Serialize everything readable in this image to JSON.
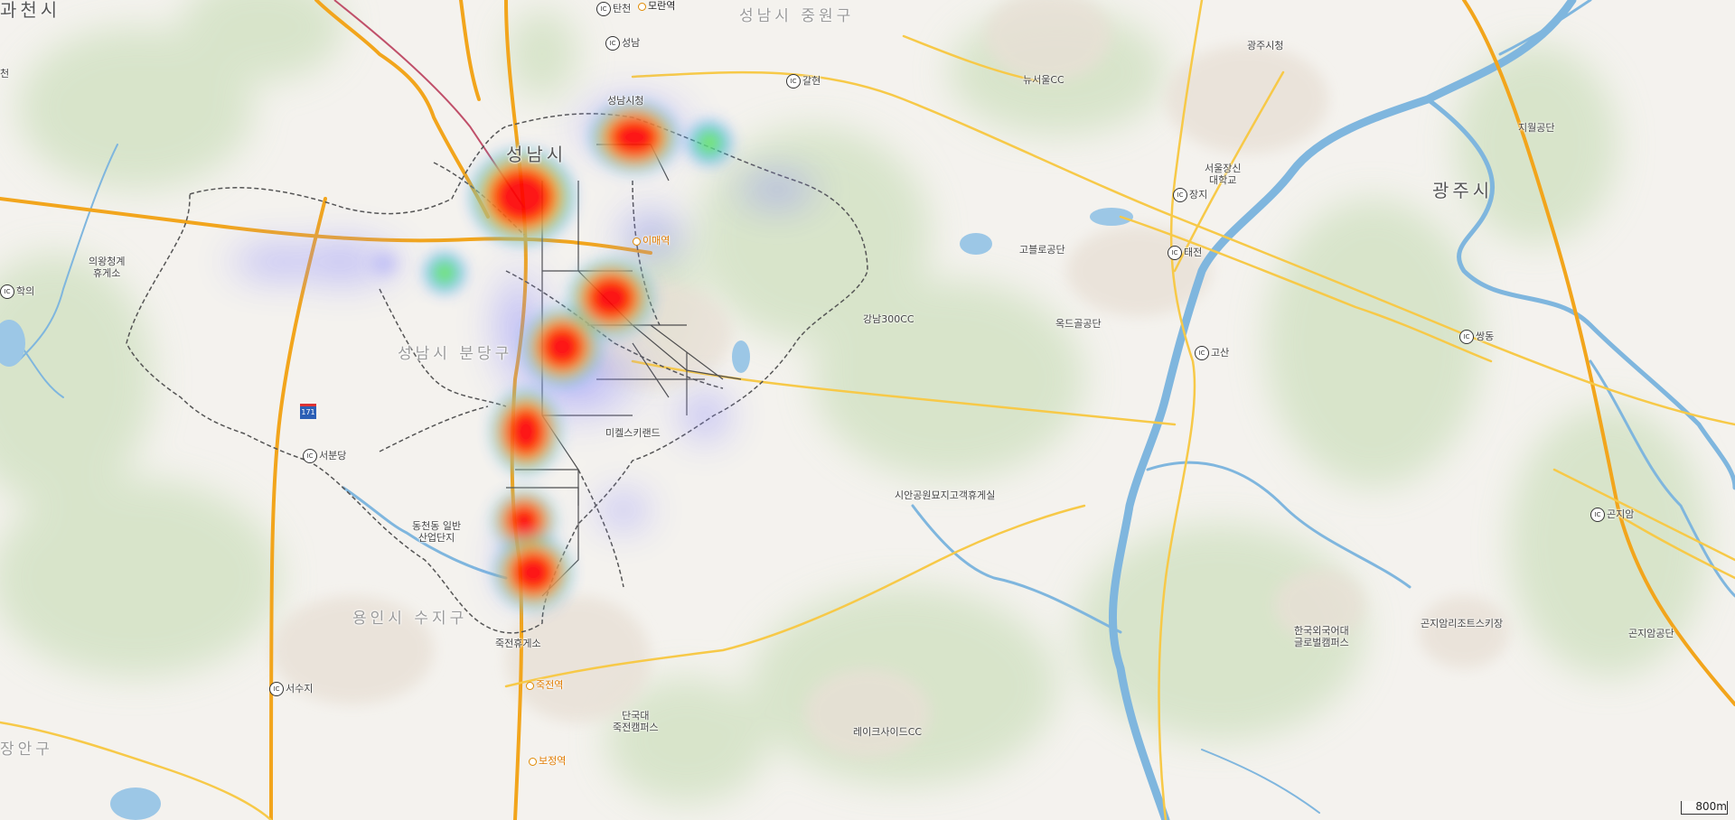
{
  "colors": {
    "background": "#f4f2ee",
    "forest": "#c5d9b4",
    "water": "#7fb6de",
    "highway": "#f2a51c",
    "road": "#f7c948",
    "boundary": "#555555",
    "heat_hot": "#ff0000",
    "heat_warm": "#ffff00",
    "heat_mid": "#00e676",
    "heat_cool": "#6a6aff"
  },
  "heatmap_intensity": {
    "levels": [
      "low",
      "medium",
      "high"
    ],
    "hotspot_count": 7,
    "secondary_spot_count": 2
  },
  "labels": {
    "city_gwacheon": "과천시",
    "city_seongnam": "성남시",
    "city_gwangju": "광주시",
    "district_jungwon": "성남시 중원구",
    "district_bundang": "성남시 분당구",
    "district_suji": "용인시 수지구",
    "district_jangan": "장안구",
    "ic_tancheon": "탄천",
    "ic_seongnam": "성남",
    "ic_galhyeon": "갈현",
    "ic_hakui": "학의",
    "ic_seobundang": "서분당",
    "ic_seosuji": "서수지",
    "ic_jangji": "장지",
    "ic_taejeon": "태전",
    "ic_gosan": "고산",
    "ic_ssangdong": "쌍동",
    "ic_gonjiam": "곤지암",
    "stn_moran": "모란역",
    "stn_imae": "이매역",
    "stn_jukjeon": "죽전역",
    "stn_bojeong": "보정역",
    "poi_seongnam_cityhall": "성남시청",
    "poi_gwangju_cityhall": "광주시청",
    "poi_newseoul_cc": "뉴서울CC",
    "poi_seoulsinhak": "서울장신\n대학교",
    "poi_jiwol": "지월공단",
    "poi_goburo": "고블로공단",
    "poi_okdeok": "옥드골공단",
    "poi_gangnam300": "강남300CC",
    "poi_uiwang_rest": "의왕청계\n휴게소",
    "poi_michael_kirland": "미켈스키랜드",
    "poi_sian_rest": "시안공원묘지고객휴게실",
    "poi_dongcheon": "동천동 일반\n산업단지",
    "poi_jukjeon_rest": "죽전휴게소",
    "poi_dankook": "단국대\n죽전캠퍼스",
    "poi_lakeside": "레이크사이드CC",
    "poi_hufs": "한국외국어대\n글로벌캠퍼스",
    "poi_gonjiam_resort": "곤지암리조트스키장",
    "poi_gonjiam_industrial": "곤지암공단",
    "poi_top_left_small": "천",
    "route_badge": "171"
  },
  "scale_bar": "800m"
}
